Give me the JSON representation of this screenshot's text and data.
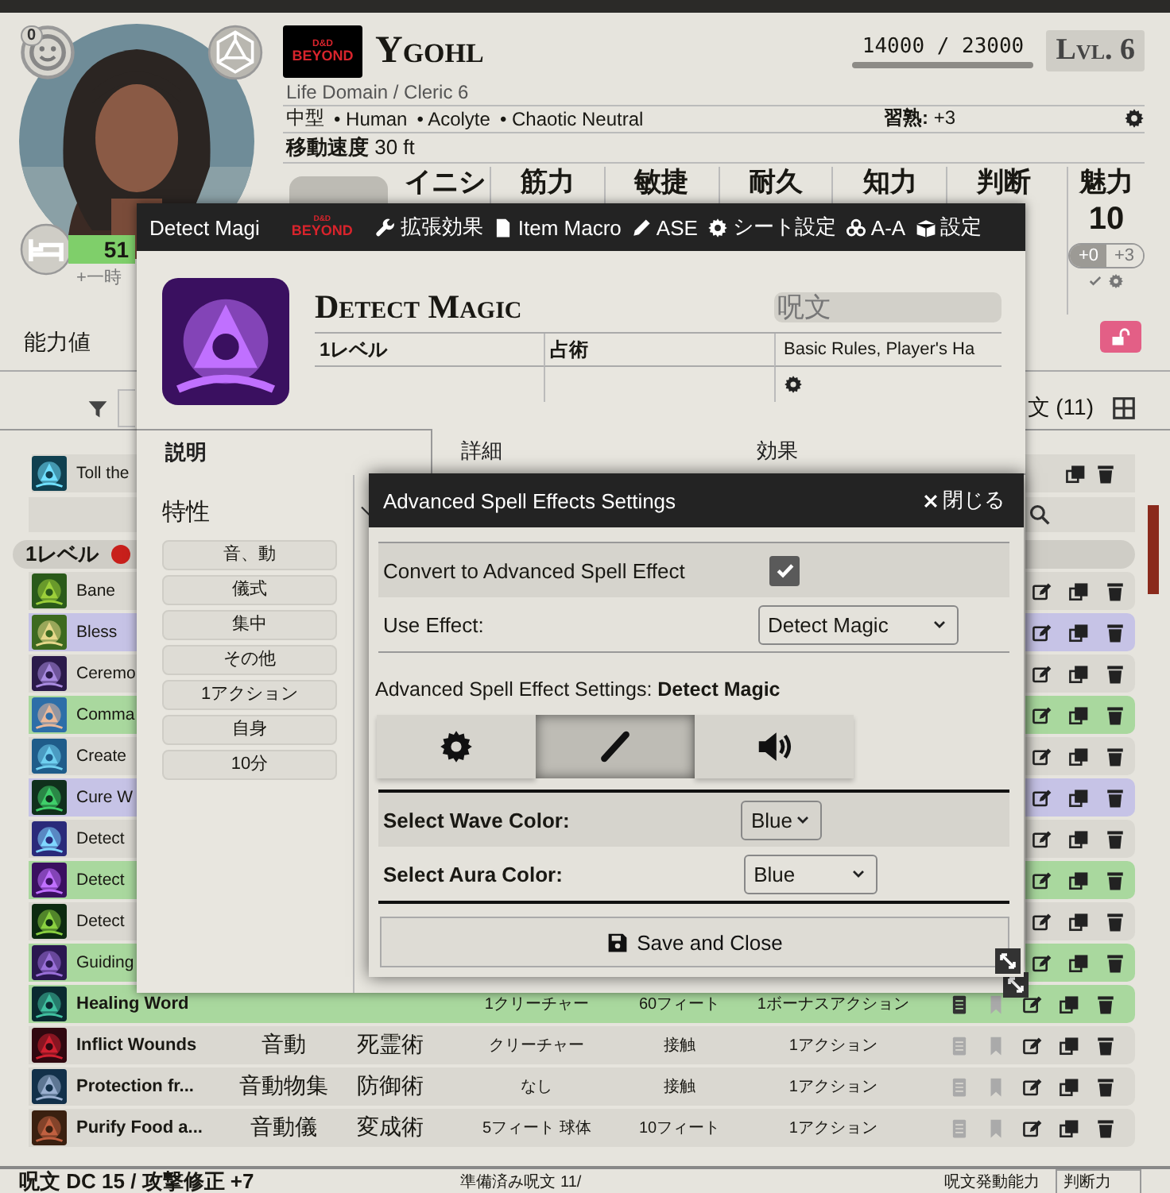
{
  "character": {
    "logo": {
      "top": "D&D",
      "bottom": "BEYOND"
    },
    "name": "Ygohl",
    "xp": "14000 / 23000",
    "level": "Lvl. 6",
    "subtitle": "Life Domain / Cleric 6",
    "size": "中型",
    "details": [
      "• Human",
      "• Acolyte",
      "• Chaotic Neutral"
    ],
    "proficiency_label": "習熟:",
    "proficiency": "+3",
    "speed_label": "移動速度",
    "speed": "30 ft",
    "inspiration": "0",
    "hp": "51",
    "temp_hp": "+一時"
  },
  "abilities": [
    {
      "name": "イニシ"
    },
    {
      "name": "筋力"
    },
    {
      "name": "敏捷"
    },
    {
      "name": "耐久"
    },
    {
      "name": "知力"
    },
    {
      "name": "判断"
    },
    {
      "name": "魅力",
      "score": "10",
      "toggles": [
        {
          "label": "+0",
          "selected": true
        },
        {
          "label": "+3",
          "selected": false
        }
      ]
    }
  ],
  "abilities_label": "能力値",
  "spell_list": {
    "count": "文 (11)",
    "first_row": "Toll the",
    "level_header": "1レベル",
    "rows": [
      {
        "name": "Bane"
      },
      {
        "name": "Bless",
        "color": "#c6c3e6"
      },
      {
        "name": "Ceremo"
      },
      {
        "name": "Comma",
        "color": "#a9d89e"
      },
      {
        "name": "Create"
      },
      {
        "name": "Cure W",
        "color": "#c6c3e6"
      },
      {
        "name": "Detect"
      },
      {
        "name": "Detect",
        "color": "#a9d89e"
      },
      {
        "name": "Detect"
      },
      {
        "name": "Guiding",
        "color": "#a9d89e"
      },
      {
        "name": "Healing Word",
        "color": "#a9d89e",
        "target": "1クリーチャー",
        "range": "60フィート",
        "time": "1ボーナスアクション",
        "prepared": true
      },
      {
        "name": "Inflict Wounds",
        "components": "音動",
        "school": "死霊術",
        "target": "クリーチャー",
        "range": "接触",
        "time": "1アクション",
        "prepared": false
      },
      {
        "name": "Protection fr...",
        "components": "音動物集",
        "school": "防御術",
        "target": "なし",
        "range": "接触",
        "time": "1アクション",
        "prepared": false
      },
      {
        "name": "Purify Food a...",
        "components": "音動儀",
        "school": "変成術",
        "target": "5フィート 球体",
        "range": "10フィート",
        "time": "1アクション",
        "prepared": false
      }
    ]
  },
  "footer": {
    "dc": "呪文 DC 15 / 攻撃修正 +7",
    "prepared": "準備済み呪文 11/",
    "ability_label": "呪文発動能力",
    "ability": "判断力"
  },
  "item_sheet": {
    "title": "Detect Magi",
    "logo": {
      "top": "D&D",
      "bottom": "BEYOND"
    },
    "header_buttons": [
      {
        "kind": "wrench",
        "label": "拡張効果"
      },
      {
        "kind": "macro",
        "label": "Item Macro"
      },
      {
        "kind": "pencil",
        "label": "ASE"
      },
      {
        "kind": "gear",
        "label": "シート設定"
      },
      {
        "kind": "biohazard",
        "label": "A-A"
      },
      {
        "kind": "box",
        "label": "設定"
      }
    ],
    "name": "Detect Magic",
    "type": "呪文",
    "level": "1レベル",
    "school": "占術",
    "source": "Basic Rules, Player's Ha",
    "tabs": [
      {
        "label": "説明",
        "selected": true
      },
      {
        "label": "詳細",
        "selected": false
      },
      {
        "label": "効果",
        "selected": false
      }
    ],
    "properties_label": "特性",
    "tags": [
      "音、動",
      "儀式",
      "集中",
      "その他",
      "1アクション",
      "自身",
      "10分"
    ]
  },
  "ase": {
    "title": "Advanced Spell Effects Settings",
    "close": "閉じる",
    "convert_label": "Convert to Advanced Spell Effect",
    "convert_checked": true,
    "use_effect_label": "Use Effect:",
    "use_effect": "Detect Magic",
    "settings_heading": "Advanced Spell Effect Settings: **Detect Magic**",
    "tabs": [
      {
        "kind": "gear",
        "selected": false
      },
      {
        "kind": "wand",
        "selected": true
      },
      {
        "kind": "sound",
        "selected": false
      }
    ],
    "selects": [
      {
        "label": "Select Wave Color:",
        "value": "Blue"
      },
      {
        "label": "Select Aura Color:",
        "value": "Blue"
      }
    ],
    "save_label": "Save and Close"
  }
}
